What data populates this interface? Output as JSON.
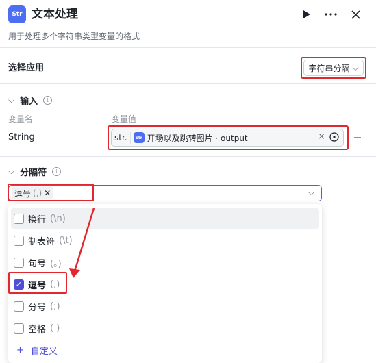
{
  "header": {
    "icon_text": "Str",
    "title": "文本处理",
    "description": "用于处理多个字符串类型变量的格式",
    "run_icon": "play-icon",
    "more_icon": "more-icon",
    "close_icon": "close-icon"
  },
  "app_section": {
    "label": "选择应用",
    "selected": "字符串分隔"
  },
  "input_section": {
    "label": "输入",
    "col_name": "变量名",
    "col_value": "变量值",
    "row": {
      "name": "String",
      "type_tag": "str.",
      "ref_text": "开场以及跳转图片 · output"
    }
  },
  "separator_section": {
    "label": "分隔符",
    "chip_name": "逗号",
    "chip_symbol": "(,)",
    "options": [
      {
        "label": "换行",
        "symbol": "(\\n)",
        "checked": false
      },
      {
        "label": "制表符",
        "symbol": "(\\t)",
        "checked": false
      },
      {
        "label": "句号",
        "symbol": "(。)",
        "checked": false
      },
      {
        "label": "逗号",
        "symbol": "(,)",
        "checked": true
      },
      {
        "label": "分号",
        "symbol": "(;)",
        "checked": false
      },
      {
        "label": "空格",
        "symbol": "( )",
        "checked": false
      }
    ],
    "add_custom": "自定义"
  },
  "colors": {
    "accent": "#4e4fd8",
    "annotation_red": "#e0282e",
    "app_icon": "#4e6ef2"
  }
}
